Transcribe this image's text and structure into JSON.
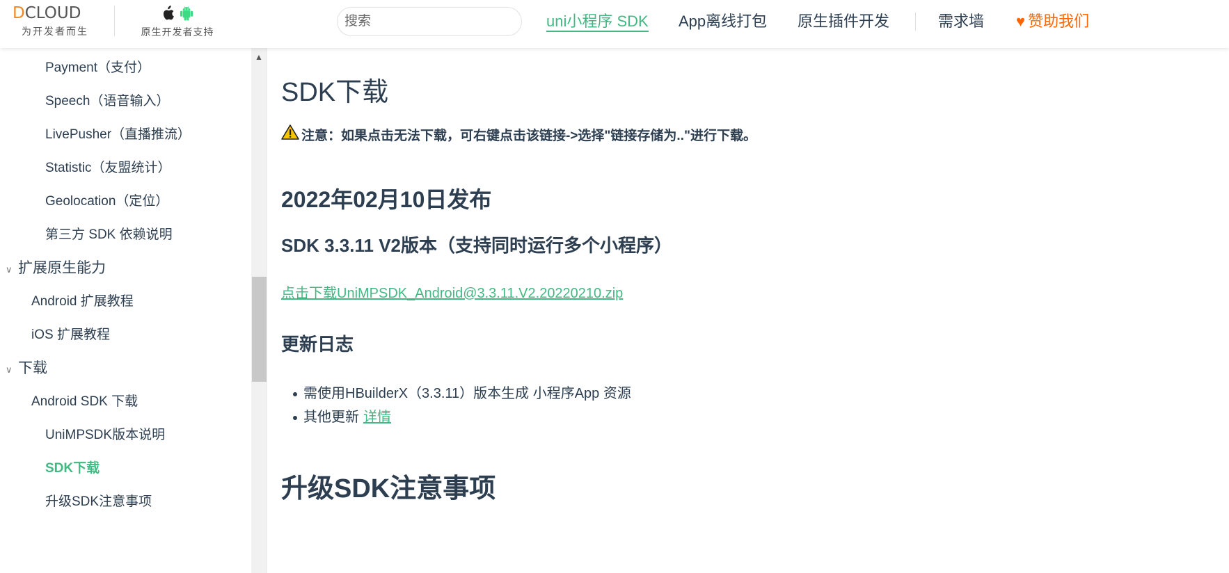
{
  "header": {
    "logo_text": "DCLOUD",
    "logo_subtitle": "为开发者而生",
    "native_label": "原生开发者支持",
    "search_placeholder": "搜索",
    "nav": [
      {
        "label": "uni小程序 SDK",
        "active": true
      },
      {
        "label": "App离线打包",
        "active": false
      },
      {
        "label": "原生插件开发",
        "active": false
      },
      {
        "label": "需求墙",
        "active": false
      },
      {
        "label": "赞助我们",
        "active": false
      }
    ],
    "accent_color": "#42b983",
    "sponsor_color": "#ff6600"
  },
  "sidebar": {
    "items": [
      {
        "label": "Payment（支付）",
        "level": 3
      },
      {
        "label": "Speech（语音输入）",
        "level": 3
      },
      {
        "label": "LivePusher（直播推流）",
        "level": 3
      },
      {
        "label": "Statistic（友盟统计）",
        "level": 3
      },
      {
        "label": "Geolocation（定位）",
        "level": 3
      },
      {
        "label": "第三方 SDK 依赖说明",
        "level": 3
      },
      {
        "label": "扩展原生能力",
        "level": 1
      },
      {
        "label": "Android 扩展教程",
        "level": 2
      },
      {
        "label": "iOS 扩展教程",
        "level": 2
      },
      {
        "label": "下载",
        "level": 1
      },
      {
        "label": "Android SDK 下载",
        "level": 2
      },
      {
        "label": "UniMPSDK版本说明",
        "level": 3
      },
      {
        "label": "SDK下载",
        "level": 3,
        "active": true
      },
      {
        "label": "升级SDK注意事项",
        "level": 3
      }
    ]
  },
  "content": {
    "title": "SDK下载",
    "notice": "注意：如果点击无法下载，可右键点击该链接->选择\"链接存储为..\"进行下载。",
    "release_date": "2022年02月10日发布",
    "version_title": "SDK 3.3.11 V2版本（支持同时运行多个小程序）",
    "download_link": "点击下载UniMPSDK_Android@3.3.11.V2.20220210.zip",
    "changelog_title": "更新日志",
    "changelog": [
      {
        "text": "需使用HBuilderX（3.3.11）版本生成 小程序App 资源",
        "link": ""
      },
      {
        "text": "其他更新",
        "link": "详情"
      }
    ],
    "next_section_title": "升级SDK注意事项"
  }
}
